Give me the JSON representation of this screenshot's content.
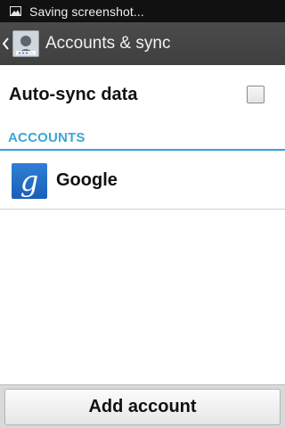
{
  "status_bar": {
    "icon": "screenshot-icon",
    "text": "Saving screenshot..."
  },
  "action_bar": {
    "title": "Accounts & sync",
    "back_icon": "chevron-left-icon",
    "app_icon": "accounts-icon"
  },
  "auto_sync": {
    "label": "Auto-sync data",
    "checked": false
  },
  "accounts_section": {
    "header": "ACCOUNTS",
    "items": [
      {
        "name": "Google",
        "icon": "google-icon",
        "icon_glyph": "g"
      }
    ]
  },
  "bottom": {
    "add_account_label": "Add account"
  },
  "colors": {
    "accent": "#39a7d4",
    "action_bar": "#444444",
    "status_bar": "#111111",
    "google_blue": "#2372cc"
  }
}
